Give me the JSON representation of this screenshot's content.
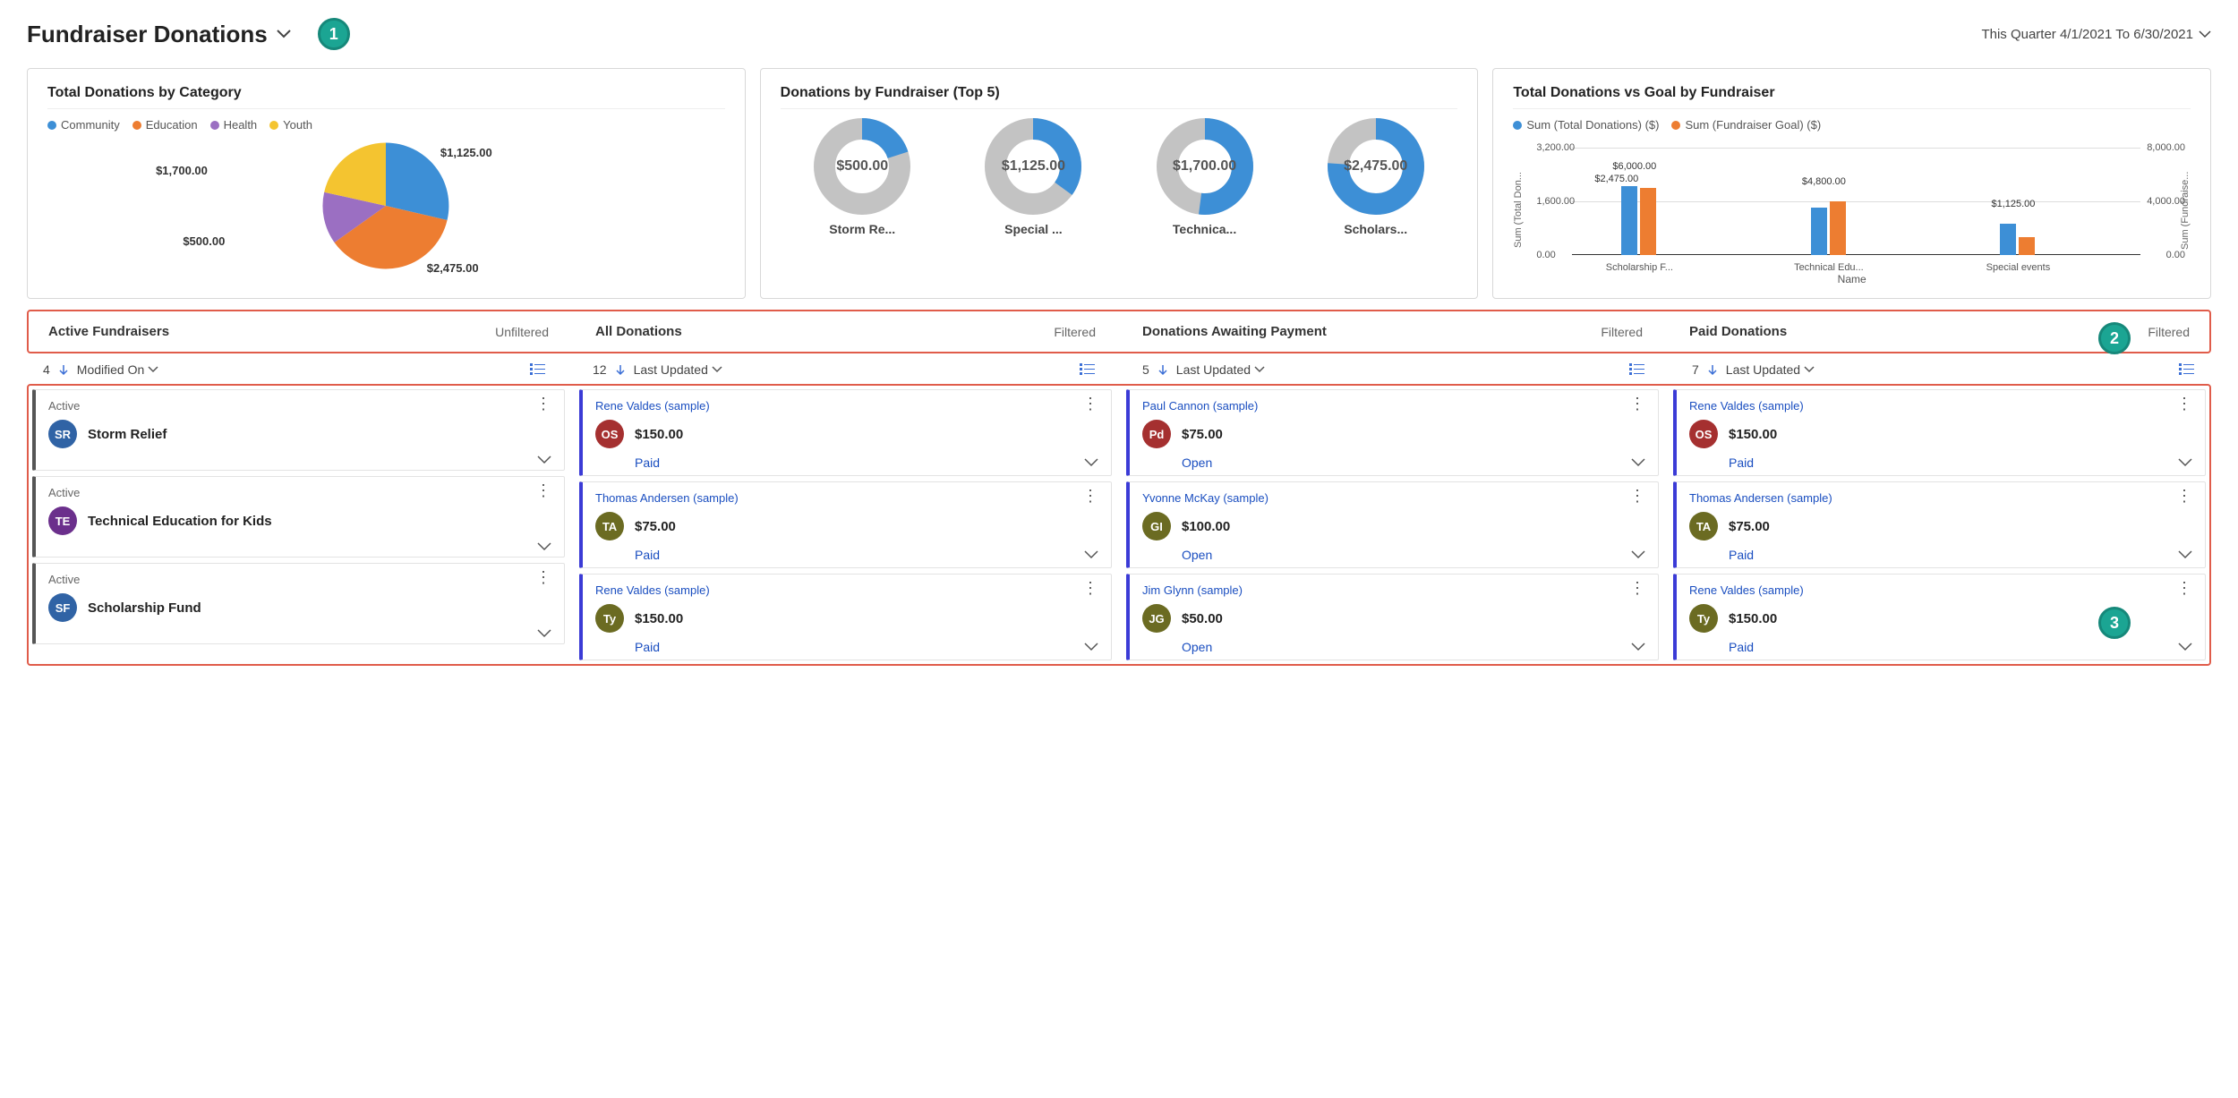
{
  "header": {
    "title": "Fundraiser Donations",
    "date_range": "This Quarter 4/1/2021 To 6/30/2021"
  },
  "badges": {
    "one": "1",
    "two": "2",
    "three": "3"
  },
  "charts": {
    "category": {
      "title": "Total Donations by Category",
      "legend": [
        {
          "label": "Community",
          "color": "#3d8fd6"
        },
        {
          "label": "Education",
          "color": "#ed7d31"
        },
        {
          "label": "Health",
          "color": "#9b6fc2"
        },
        {
          "label": "Youth",
          "color": "#f4c430"
        }
      ],
      "labels": {
        "community": "$1,125.00",
        "education": "$2,475.00",
        "health": "$500.00",
        "youth": "$1,700.00"
      }
    },
    "top5": {
      "title": "Donations by Fundraiser (Top 5)",
      "items": [
        {
          "value": "$500.00",
          "label": "Storm Re...",
          "pct": 20
        },
        {
          "value": "$1,125.00",
          "label": "Special ...",
          "pct": 35
        },
        {
          "value": "$1,700.00",
          "label": "Technica...",
          "pct": 52
        },
        {
          "value": "$2,475.00",
          "label": "Scholars...",
          "pct": 76
        }
      ]
    },
    "goal": {
      "title": "Total Donations vs Goal by Fundraiser",
      "legend": [
        {
          "label": "Sum (Total Donations) ($)",
          "color": "#3d8fd6"
        },
        {
          "label": "Sum (Fundraiser Goal) ($)",
          "color": "#ed7d31"
        }
      ],
      "y_left_label": "Sum (Total Don...",
      "y_right_label": "Sum (Fundraise...",
      "y_left_ticks": [
        "3,200.00",
        "1,600.00",
        "0.00"
      ],
      "y_right_ticks": [
        "8,000.00",
        "4,000.00",
        "0.00"
      ],
      "x_label": "Name",
      "bars": [
        {
          "name": "Scholarship F...",
          "val_label": "$2,475.00",
          "goal_label": "$6,000.00",
          "val_h": 77,
          "goal_h": 75
        },
        {
          "name": "Technical Edu...",
          "val_label": "",
          "goal_label": "$4,800.00",
          "val_h": 53,
          "goal_h": 60
        },
        {
          "name": "Special events",
          "val_label": "",
          "goal_label": "$1,125.00",
          "val_h": 35,
          "goal_h": 20
        }
      ]
    }
  },
  "chart_data": [
    {
      "type": "pie",
      "title": "Total Donations by Category",
      "series": [
        {
          "name": "Community",
          "value": 1125.0
        },
        {
          "name": "Education",
          "value": 2475.0
        },
        {
          "name": "Health",
          "value": 500.0
        },
        {
          "name": "Youth",
          "value": 1700.0
        }
      ]
    },
    {
      "type": "pie",
      "title": "Donations by Fundraiser (Top 5)",
      "subtype": "donut-multiples",
      "items": [
        {
          "name": "Storm Re...",
          "value": 500.0
        },
        {
          "name": "Special ...",
          "value": 1125.0
        },
        {
          "name": "Technica...",
          "value": 1700.0
        },
        {
          "name": "Scholars...",
          "value": 2475.0
        }
      ]
    },
    {
      "type": "bar",
      "title": "Total Donations vs Goal by Fundraiser",
      "categories": [
        "Scholarship F...",
        "Technical Edu...",
        "Special events"
      ],
      "series": [
        {
          "name": "Sum (Total Donations) ($)",
          "values": [
            2475.0,
            1700.0,
            1125.0
          ],
          "axis": "left"
        },
        {
          "name": "Sum (Fundraiser Goal) ($)",
          "values": [
            6000.0,
            4800.0,
            1125.0
          ],
          "axis": "right"
        }
      ],
      "xlabel": "Name",
      "ylabel_left": "Sum (Total Donations) ($)",
      "ylabel_right": "Sum (Fundraiser Goal) ($)",
      "ylim_left": [
        0,
        3200
      ],
      "ylim_right": [
        0,
        8000
      ]
    }
  ],
  "lists": [
    {
      "title": "Active Fundraisers",
      "filter": "Unfiltered",
      "count": "4",
      "sort": "Modified On",
      "edge": "gray",
      "cards": [
        {
          "top_text": "Active",
          "avatar": "SR",
          "avatar_color": "#3063a5",
          "title": "Storm Relief"
        },
        {
          "top_text": "Active",
          "avatar": "TE",
          "avatar_color": "#6b2f8c",
          "title": "Technical Education for Kids"
        },
        {
          "top_text": "Active",
          "avatar": "SF",
          "avatar_color": "#3063a5",
          "title": "Scholarship Fund"
        }
      ]
    },
    {
      "title": "All Donations",
      "filter": "Filtered",
      "count": "12",
      "sort": "Last Updated",
      "edge": "blue",
      "cards": [
        {
          "top_text": "Rene Valdes (sample)",
          "link": true,
          "avatar": "OS",
          "avatar_color": "#a53030",
          "amount": "$150.00",
          "status": "Paid"
        },
        {
          "top_text": "Thomas Andersen (sample)",
          "link": true,
          "avatar": "TA",
          "avatar_color": "#6b6b22",
          "amount": "$75.00",
          "status": "Paid"
        },
        {
          "top_text": "Rene Valdes (sample)",
          "link": true,
          "avatar": "Ty",
          "avatar_color": "#6b6b22",
          "amount": "$150.00",
          "status": "Paid"
        }
      ]
    },
    {
      "title": "Donations Awaiting Payment",
      "filter": "Filtered",
      "count": "5",
      "sort": "Last Updated",
      "edge": "blue",
      "cards": [
        {
          "top_text": "Paul Cannon (sample)",
          "link": true,
          "avatar": "Pd",
          "avatar_color": "#a53030",
          "amount": "$75.00",
          "status": "Open"
        },
        {
          "top_text": "Yvonne McKay (sample)",
          "link": true,
          "avatar": "GI",
          "avatar_color": "#6b6b22",
          "amount": "$100.00",
          "status": "Open"
        },
        {
          "top_text": "Jim Glynn (sample)",
          "link": true,
          "avatar": "JG",
          "avatar_color": "#6b6b22",
          "amount": "$50.00",
          "status": "Open"
        }
      ]
    },
    {
      "title": "Paid Donations",
      "filter": "Filtered",
      "count": "7",
      "sort": "Last Updated",
      "edge": "blue",
      "cards": [
        {
          "top_text": "Rene Valdes (sample)",
          "link": true,
          "avatar": "OS",
          "avatar_color": "#a53030",
          "amount": "$150.00",
          "status": "Paid"
        },
        {
          "top_text": "Thomas Andersen (sample)",
          "link": true,
          "avatar": "TA",
          "avatar_color": "#6b6b22",
          "amount": "$75.00",
          "status": "Paid"
        },
        {
          "top_text": "Rene Valdes (sample)",
          "link": true,
          "avatar": "Ty",
          "avatar_color": "#6b6b22",
          "amount": "$150.00",
          "status": "Paid"
        }
      ]
    }
  ]
}
